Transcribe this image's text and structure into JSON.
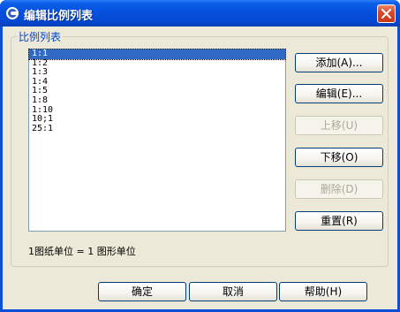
{
  "window": {
    "title": "编辑比例列表"
  },
  "group": {
    "label": "比例列表"
  },
  "scale_list": {
    "items": [
      "1:1",
      "1:2",
      "1:3",
      "1:4",
      "1:5",
      "1:8",
      "1:10",
      "10;1",
      "25:1"
    ],
    "selected_index": 0
  },
  "side_buttons": {
    "add": "添加(A)...",
    "edit": "编辑(E)...",
    "move_up": "上移(U)",
    "move_down": "下移(O)",
    "delete": "删除(D)",
    "reset": "重置(R)"
  },
  "units_text": "1图纸单位 = 1 图形单位",
  "footer_buttons": {
    "ok": "确定",
    "cancel": "取消",
    "help": "帮助(H)"
  }
}
